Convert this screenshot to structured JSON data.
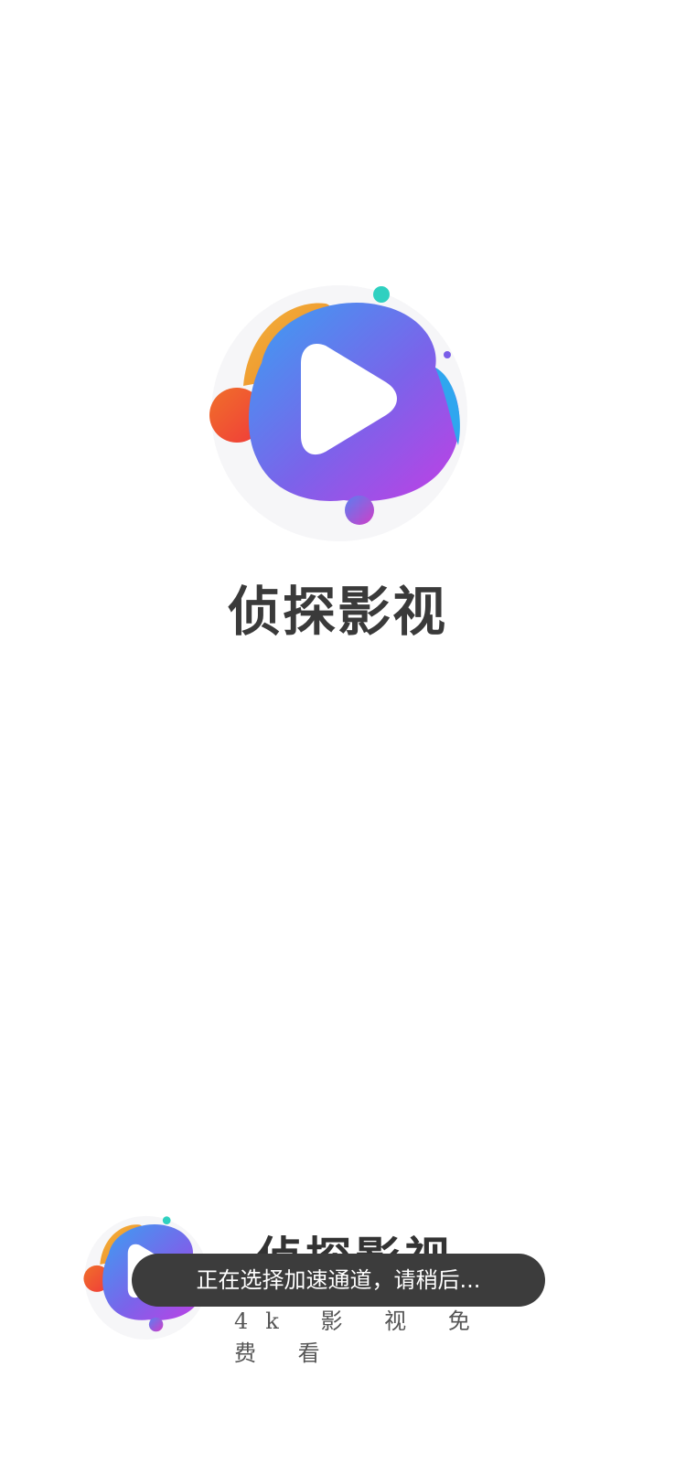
{
  "app": {
    "name": "侦探影视"
  },
  "footer": {
    "name": "侦探影视",
    "slogan": "4k 影 视 免 费 看"
  },
  "toast": {
    "message": "正在选择加速通道，请稍后..."
  },
  "colors": {
    "blob_blue": "#3f8ef0",
    "blob_purple": "#b040e0",
    "accent_orange": "#f0a030",
    "accent_red": "#f04a2a",
    "accent_teal": "#2fd0c0",
    "title_text": "#3a3a3a",
    "toast_bg": "#3c3c3c"
  },
  "icons": {
    "main_logo": "play-blob-icon",
    "footer_logo": "play-blob-icon"
  }
}
